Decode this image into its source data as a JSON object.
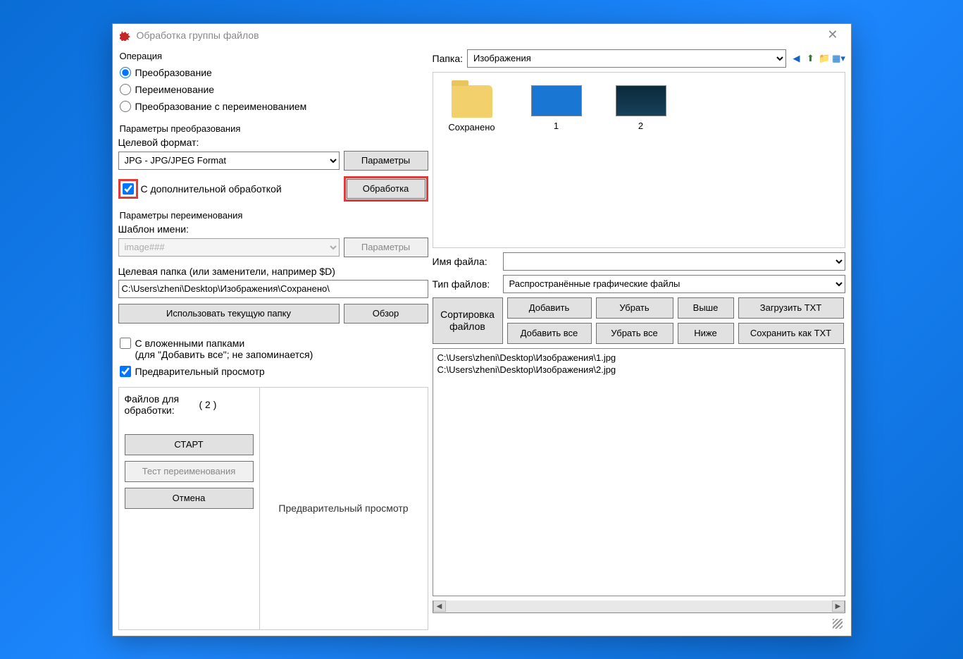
{
  "window": {
    "title": "Обработка группы файлов"
  },
  "operation": {
    "legend": "Операция",
    "opt_convert": "Преобразование",
    "opt_rename": "Переименование",
    "opt_both": "Преобразование с переименованием"
  },
  "convert": {
    "legend": "Параметры преобразования",
    "target_format_label": "Целевой формат:",
    "target_format_value": "JPG - JPG/JPEG Format",
    "params_btn": "Параметры",
    "extra_processing_label": "С дополнительной обработкой",
    "processing_btn": "Обработка"
  },
  "rename": {
    "legend": "Параметры переименования",
    "pattern_label": "Шаблон имени:",
    "pattern_value": "image###",
    "params_btn": "Параметры"
  },
  "target_folder": {
    "label": "Целевая папка (или заменители, например $D)",
    "value": "C:\\Users\\zheni\\Desktop\\Изображения\\Сохранено\\",
    "use_current_btn": "Использовать текущую папку",
    "browse_btn": "Обзор"
  },
  "options": {
    "subfolders_label1": "С вложенными папками",
    "subfolders_label2": "(для \"Добавить все\"; не запоминается)",
    "preview_label": "Предварительный просмотр"
  },
  "footer": {
    "files_for_label": "Файлов для обработки:",
    "files_count": "( 2 )",
    "start_btn": "СТАРТ",
    "test_rename_btn": "Тест переименования",
    "cancel_btn": "Отмена",
    "preview_pane_label": "Предварительный просмотр"
  },
  "browser": {
    "folder_label": "Папка:",
    "folder_value": "Изображения",
    "items": {
      "saved": "Сохранено",
      "one": "1",
      "two": "2"
    }
  },
  "file_fields": {
    "filename_label": "Имя файла:",
    "filename_value": "",
    "filetype_label": "Тип файлов:",
    "filetype_value": "Распространённые графические файлы"
  },
  "sort": {
    "box_label": "Сортировка файлов",
    "add": "Добавить",
    "remove": "Убрать",
    "up": "Выше",
    "load_txt": "Загрузить TXT",
    "add_all": "Добавить все",
    "remove_all": "Убрать все",
    "down": "Ниже",
    "save_txt": "Сохранить как TXT"
  },
  "file_list": {
    "f1": "C:\\Users\\zheni\\Desktop\\Изображения\\1.jpg",
    "f2": "C:\\Users\\zheni\\Desktop\\Изображения\\2.jpg"
  }
}
